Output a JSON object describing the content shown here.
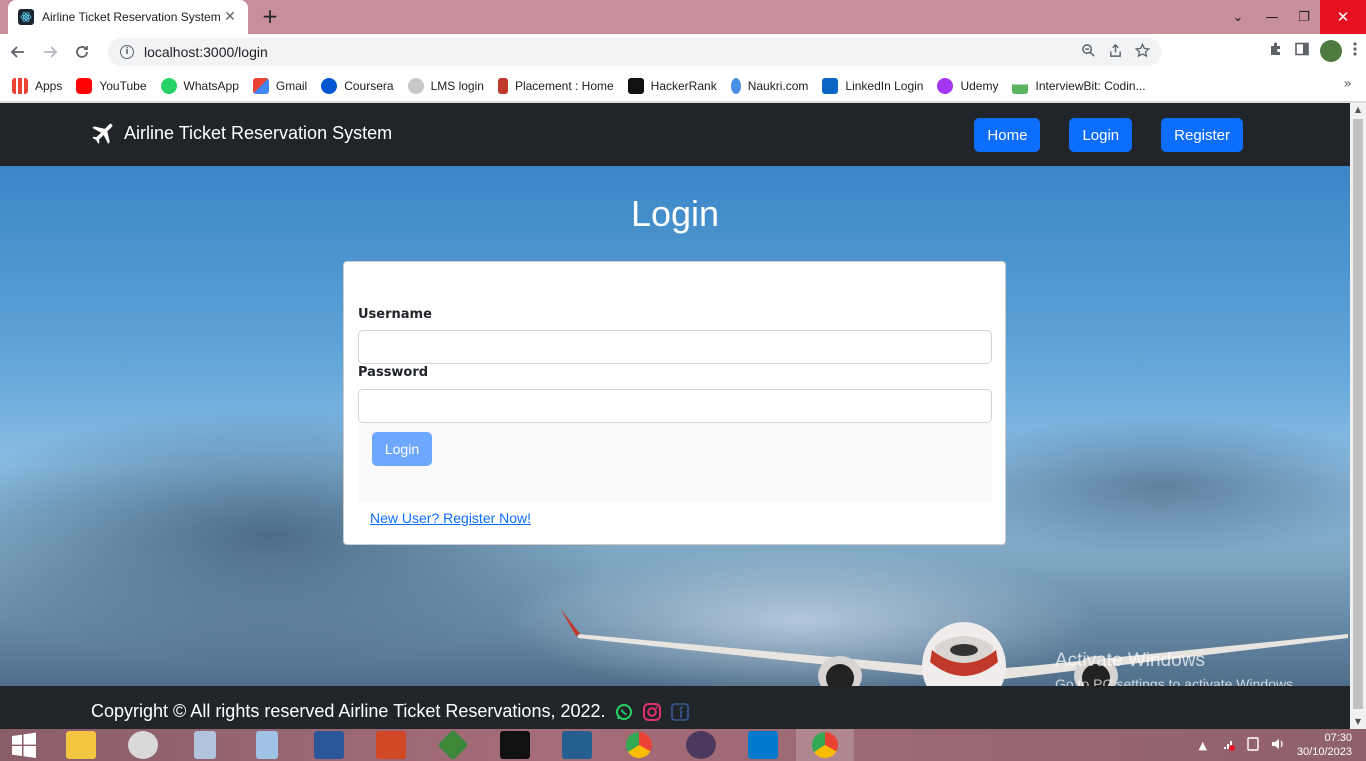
{
  "browser": {
    "tab_title": "Airline Ticket Reservation System",
    "tab_close": "✕",
    "new_tab": "+",
    "url": "localhost:3000/login",
    "window_minimize": "—",
    "window_restore": "❐",
    "window_close": "✕",
    "tab_search": "⌄"
  },
  "bookmarks": [
    {
      "label": "Apps",
      "icon": "apps-grid-icon",
      "color": "#ea4335"
    },
    {
      "label": "YouTube",
      "icon": "youtube-icon",
      "color": "#ff0000"
    },
    {
      "label": "WhatsApp",
      "icon": "whatsapp-icon",
      "color": "#25d366"
    },
    {
      "label": "Gmail",
      "icon": "gmail-icon",
      "color": "#ea4335"
    },
    {
      "label": "Coursera",
      "icon": "coursera-icon",
      "color": "#0056d2"
    },
    {
      "label": "LMS login",
      "icon": "lms-icon",
      "color": "#b0b0b0"
    },
    {
      "label": "Placement : Home",
      "icon": "placement-icon",
      "color": "#c0392b"
    },
    {
      "label": "HackerRank",
      "icon": "hackerrank-icon",
      "color": "#111111"
    },
    {
      "label": "Naukri.com",
      "icon": "naukri-icon",
      "color": "#4a90e2"
    },
    {
      "label": "LinkedIn Login",
      "icon": "linkedin-icon",
      "color": "#0a66c2"
    },
    {
      "label": "Udemy",
      "icon": "udemy-icon",
      "color": "#a435f0"
    },
    {
      "label": "InterviewBit: Codin...",
      "icon": "interviewbit-icon",
      "color": "#5bb462"
    }
  ],
  "bookmarks_more": "»",
  "navbar": {
    "brand": "Airline Ticket Reservation System",
    "home": "Home",
    "login": "Login",
    "register": "Register"
  },
  "page": {
    "title": "Login",
    "username_label": "Username",
    "username_value": "",
    "password_label": "Password",
    "password_value": "",
    "submit": "Login",
    "register_link": "New User? Register Now!"
  },
  "footer": {
    "copyright": "Copyright © All rights reserved Airline Ticket Reservations, 2022."
  },
  "watermark": {
    "line1": "Activate Windows",
    "line2": "Go to PC settings to activate Windows."
  },
  "taskbar": {
    "apps": [
      {
        "icon": "file-explorer-icon",
        "color": "#f4c542"
      },
      {
        "icon": "snipping-tool-icon",
        "color": "#d9d9d9"
      },
      {
        "icon": "calculator-icon",
        "color": "#b0c4de"
      },
      {
        "icon": "notepad-icon",
        "color": "#9fc3e7"
      },
      {
        "icon": "word-icon",
        "color": "#2b579a"
      },
      {
        "icon": "powerpoint-icon",
        "color": "#d24726"
      },
      {
        "icon": "nodejs-icon",
        "color": "#3c873a"
      },
      {
        "icon": "mysql-shell-icon",
        "color": "#111111"
      },
      {
        "icon": "mysql-workbench-icon",
        "color": "#245f8f"
      },
      {
        "icon": "chrome-icon",
        "color": "#ea4335"
      },
      {
        "icon": "java-ee-ide-icon",
        "color": "#4b3a5e"
      },
      {
        "icon": "vscode-icon",
        "color": "#007acc"
      },
      {
        "icon": "chrome-active-icon",
        "color": "#ea4335"
      }
    ],
    "time": "07:30",
    "date": "30/10/2023"
  }
}
